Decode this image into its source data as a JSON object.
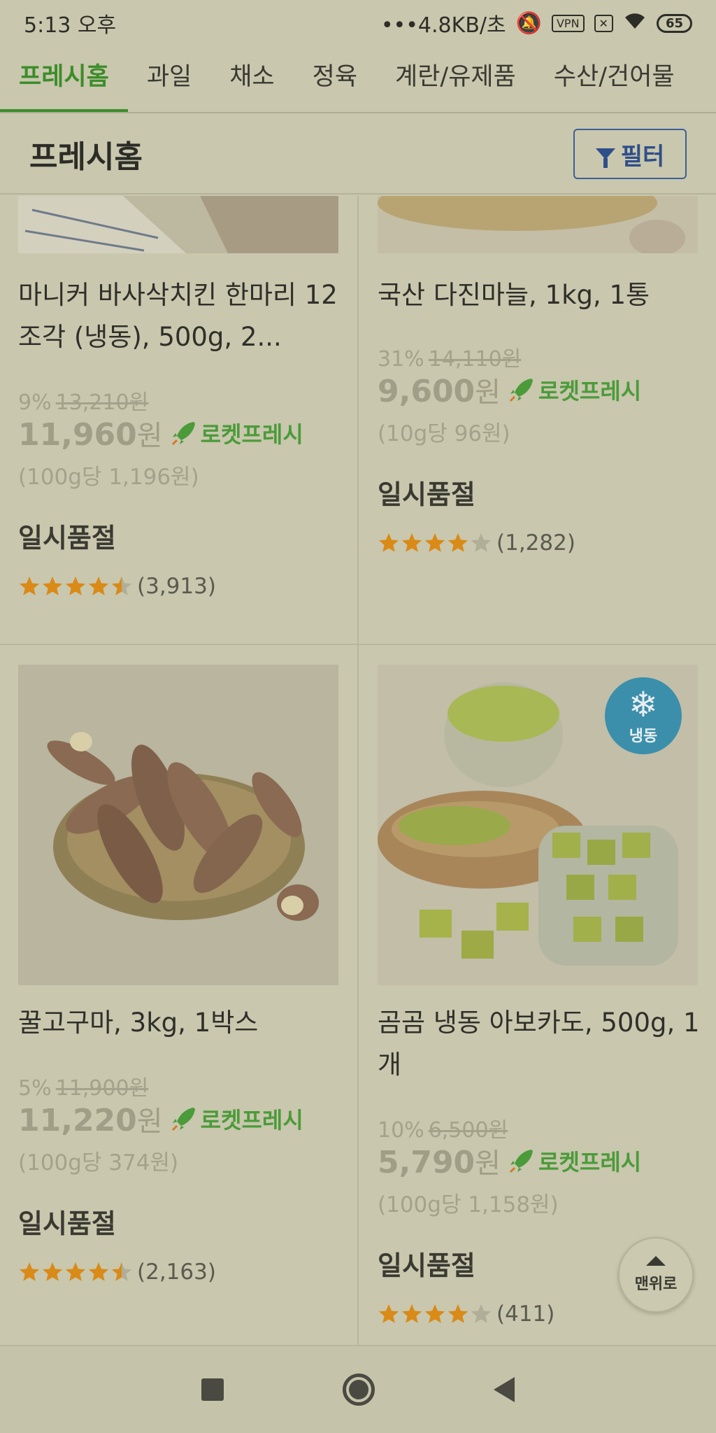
{
  "status_bar": {
    "time": "5:13 오후",
    "network": "•••4.8KB/초",
    "vpn": "VPN",
    "battery": "65"
  },
  "tabs": [
    "프레시홈",
    "과일",
    "채소",
    "정육",
    "계란/유제품",
    "수산/건어물"
  ],
  "header": {
    "title": "프레시홈",
    "filter_label": "필터"
  },
  "products": [
    {
      "name": "마니커 바사삭치킨 한마리 12조각 (냉동), 500g, 2...",
      "discount": "9%",
      "original_price": "13,210원",
      "price": "11,960",
      "currency": "원",
      "delivery_badge": "로켓프레시",
      "unit_price": "(100g당 1,196원)",
      "status": "일시품절",
      "rating": 4.5,
      "review_count": "(3,913)"
    },
    {
      "name": "국산 다진마늘, 1kg, 1통",
      "discount": "31%",
      "original_price": "14,110원",
      "price": "9,600",
      "currency": "원",
      "delivery_badge": "로켓프레시",
      "unit_price": "(10g당 96원)",
      "status": "일시품절",
      "rating": 4,
      "review_count": "(1,282)"
    },
    {
      "name": "꿀고구마, 3kg, 1박스",
      "discount": "5%",
      "original_price": "11,900원",
      "price": "11,220",
      "currency": "원",
      "delivery_badge": "로켓프레시",
      "unit_price": "(100g당 374원)",
      "status": "일시품절",
      "rating": 4.5,
      "review_count": "(2,163)"
    },
    {
      "name": "곰곰 냉동 아보카도, 500g, 1개",
      "discount": "10%",
      "original_price": "6,500원",
      "price": "5,790",
      "currency": "원",
      "delivery_badge": "로켓프레시",
      "unit_price": "(100g당 1,158원)",
      "status": "일시품절",
      "rating": 4,
      "review_count": "(411)",
      "badge": "냉동"
    }
  ],
  "scroll_top_label": "맨위로",
  "colors": {
    "accent_green": "#3b8d2a",
    "rocket_green": "#4b9b3a",
    "filter_blue": "#2f4f8a",
    "star_orange": "#d98a17",
    "star_empty": "#b0ae98",
    "frozen_blue": "#3b8fab"
  }
}
